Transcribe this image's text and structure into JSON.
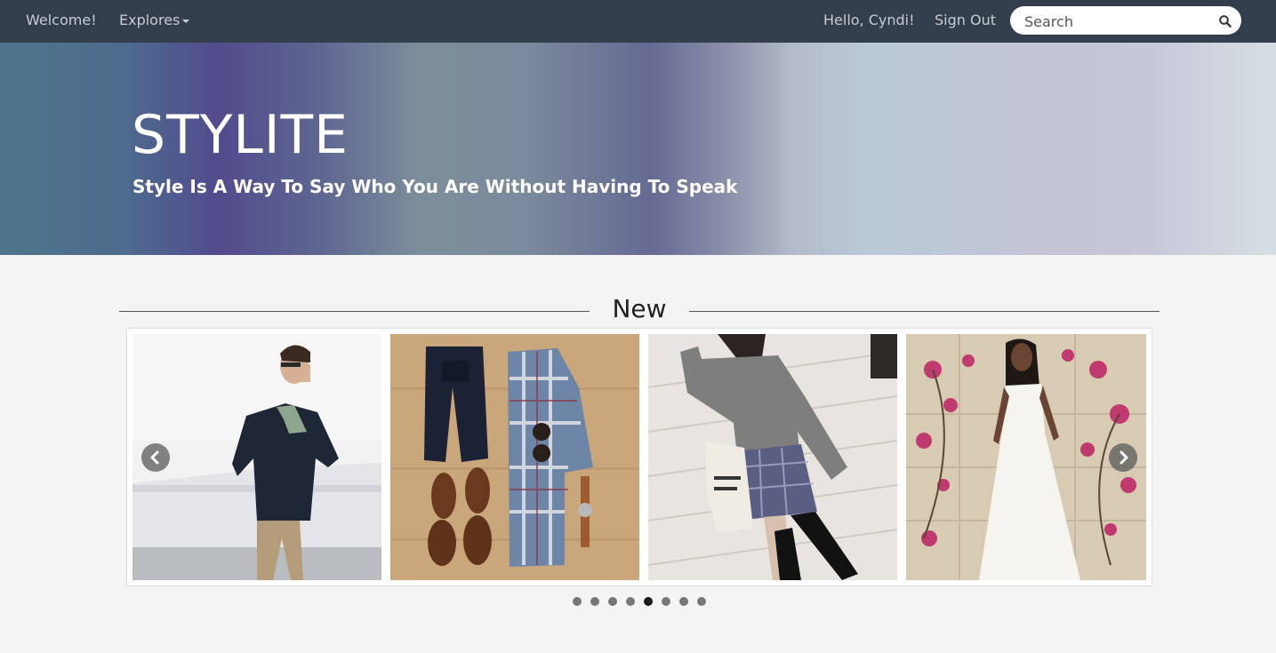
{
  "nav": {
    "welcome": "Welcome!",
    "explores": "Explores",
    "greeting": "Hello, Cyndi!",
    "sign_out": "Sign Out",
    "search_placeholder": "Search",
    "search_value": ""
  },
  "hero": {
    "title": "STYLITE",
    "tagline": "Style Is A Way To Say Who You Are Without Having To Speak"
  },
  "section": {
    "title": "New"
  },
  "carousel": {
    "items": [
      {
        "name": "man-navy-blazer-photo"
      },
      {
        "name": "flat-lay-plaid-shirt-photo"
      },
      {
        "name": "grey-sweater-plaid-skirt-photo"
      },
      {
        "name": "white-maxi-dress-photo"
      }
    ],
    "page_count": 8,
    "active_page": 5
  },
  "colors": {
    "navbar": "#333e4d",
    "page_background": "#f4f4f4",
    "active_dot": "#1a1a1a",
    "inactive_dot": "#777777"
  }
}
